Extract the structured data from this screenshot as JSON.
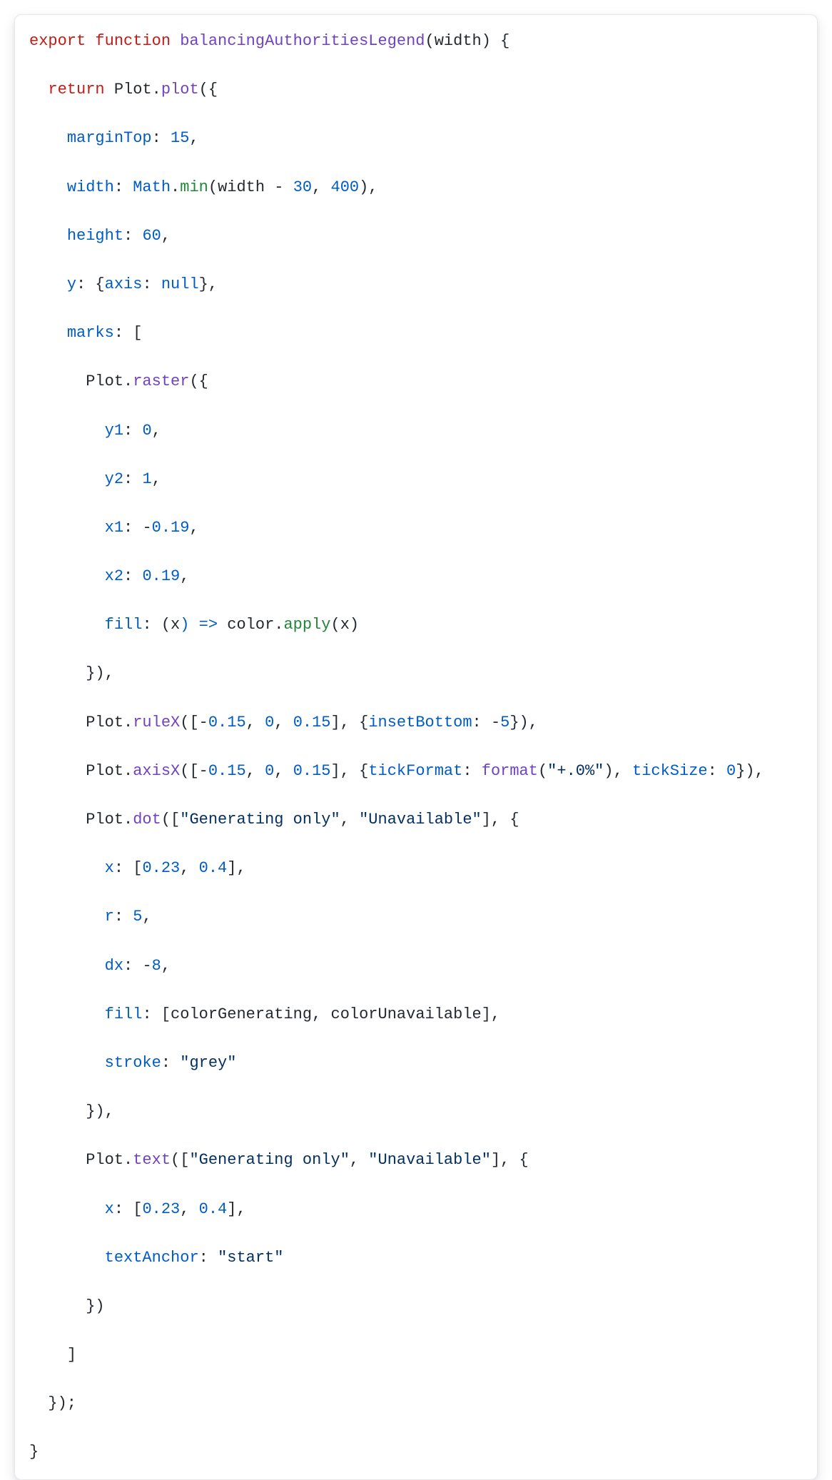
{
  "code": {
    "l1": {
      "kw_export": "export",
      "kw_function": "function",
      "fn_name": "balancingAuthoritiesLegend",
      "paren_open": "(",
      "param": "width",
      "paren_close_brace": ") {"
    },
    "l2": {
      "indent": "  ",
      "kw_return": "return",
      "sp": " ",
      "obj": "Plot",
      "dot": ".",
      "method": "plot",
      "tail": "({"
    },
    "l3": {
      "indent": "    ",
      "prop": "marginTop",
      "colon": ": ",
      "val": "15",
      "comma": ","
    },
    "l4": {
      "indent": "    ",
      "prop": "width",
      "colon": ": ",
      "obj": "Math",
      "dot": ".",
      "method": "min",
      "args_open": "(",
      "arg1": "width",
      "minus": " - ",
      "n1": "30",
      "comma1": ", ",
      "n2": "400",
      "tail": "),"
    },
    "l5": {
      "indent": "    ",
      "prop": "height",
      "colon": ": ",
      "val": "60",
      "comma": ","
    },
    "l6": {
      "indent": "    ",
      "prop": "y",
      "colon": ": {",
      "inner_prop": "axis",
      "inner_colon": ": ",
      "inner_val": "null",
      "tail": "},"
    },
    "l7": {
      "indent": "    ",
      "prop": "marks",
      "tail": ": ["
    },
    "l8": {
      "indent": "      ",
      "obj": "Plot",
      "dot": ".",
      "method": "raster",
      "tail": "({"
    },
    "l9": {
      "indent": "        ",
      "prop": "y1",
      "colon": ": ",
      "val": "0",
      "comma": ","
    },
    "l10": {
      "indent": "        ",
      "prop": "y2",
      "colon": ": ",
      "val": "1",
      "comma": ","
    },
    "l11": {
      "indent": "        ",
      "prop": "x1",
      "colon": ": ",
      "minus": "-",
      "val": "0.19",
      "comma": ","
    },
    "l12": {
      "indent": "        ",
      "prop": "x2",
      "colon": ": ",
      "val": "0.19",
      "comma": ","
    },
    "l13": {
      "indent": "        ",
      "prop": "fill",
      "colon": ": (",
      "arg": "x",
      "arrow": ") => ",
      "obj": "color",
      "dot": ".",
      "method": "apply",
      "tail_open": "(",
      "arg2": "x",
      "tail_close": ")"
    },
    "l14": {
      "indent": "      ",
      "tail": "}),"
    },
    "l15": {
      "indent": "      ",
      "obj": "Plot",
      "dot": ".",
      "method": "ruleX",
      "open": "([",
      "m1": "-",
      "n1": "0.15",
      "c1": ", ",
      "n2": "0",
      "c2": ", ",
      "n3": "0.15",
      "close_arr": "], {",
      "prop": "insetBottom",
      "colon": ": ",
      "m2": "-",
      "n4": "5",
      "tail": "}),"
    },
    "l16": {
      "indent": "      ",
      "obj": "Plot",
      "dot": ".",
      "method": "axisX",
      "open": "([",
      "m1": "-",
      "n1": "0.15",
      "c1": ", ",
      "n2": "0",
      "c2": ", ",
      "n3": "0.15",
      "close_arr": "], {",
      "p1": "tickFormat",
      "colon1": ": ",
      "fn": "format",
      "fargs_open": "(",
      "fmt": "\"+.0%\"",
      "fargs_close": "), ",
      "p2": "tickSize",
      "colon2": ": ",
      "n4": "0",
      "tail": "}),"
    },
    "l17": {
      "indent": "      ",
      "obj": "Plot",
      "dot": ".",
      "method": "dot",
      "open": "([",
      "s1": "\"Generating only\"",
      "c1": ", ",
      "s2": "\"Unavailable\"",
      "close_arr": "], {"
    },
    "l18": {
      "indent": "        ",
      "prop": "x",
      "colon": ": [",
      "n1": "0.23",
      "c1": ", ",
      "n2": "0.4",
      "tail": "],"
    },
    "l19": {
      "indent": "        ",
      "prop": "r",
      "colon": ": ",
      "val": "5",
      "comma": ","
    },
    "l20": {
      "indent": "        ",
      "prop": "dx",
      "colon": ": ",
      "minus": "-",
      "val": "8",
      "comma": ","
    },
    "l21": {
      "indent": "        ",
      "prop": "fill",
      "colon": ": [",
      "v1": "colorGenerating",
      "c1": ", ",
      "v2": "colorUnavailable",
      "tail": "],"
    },
    "l22": {
      "indent": "        ",
      "prop": "stroke",
      "colon": ": ",
      "val": "\"grey\""
    },
    "l23": {
      "indent": "      ",
      "tail": "}),"
    },
    "l24": {
      "indent": "      ",
      "obj": "Plot",
      "dot": ".",
      "method": "text",
      "open": "([",
      "s1": "\"Generating only\"",
      "c1": ", ",
      "s2": "\"Unavailable\"",
      "close_arr": "], {"
    },
    "l25": {
      "indent": "        ",
      "prop": "x",
      "colon": ": [",
      "n1": "0.23",
      "c1": ", ",
      "n2": "0.4",
      "tail": "],"
    },
    "l26": {
      "indent": "        ",
      "prop": "textAnchor",
      "colon": ": ",
      "val": "\"start\""
    },
    "l27": {
      "indent": "      ",
      "tail": "})"
    },
    "l28": {
      "indent": "    ",
      "tail": "]"
    },
    "l29": {
      "indent": "  ",
      "tail": "});"
    },
    "l30": {
      "tail": "}"
    }
  }
}
